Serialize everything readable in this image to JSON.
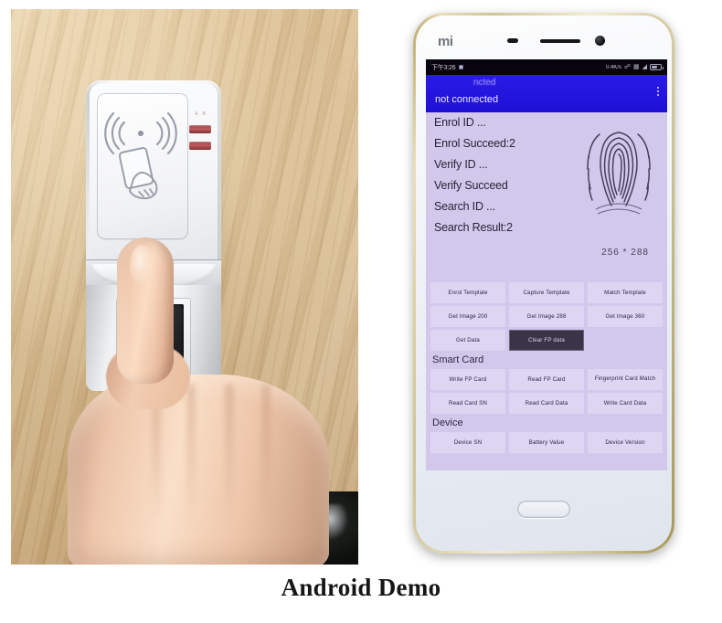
{
  "caption": "Android Demo",
  "left_photo": {
    "alt_name": "fingerprint-rfid-scanner-photo",
    "device_brand_text": "",
    "led_label": "A  B"
  },
  "phone": {
    "brand_logo": "mi",
    "status_bar": {
      "clock": "下午3:26",
      "net_rate": "0.4K/s",
      "icons": [
        "bluetooth-icon",
        "sim-icon",
        "wifi-icon",
        "battery-icon"
      ]
    },
    "action_bar": {
      "ghost_title": "ncted",
      "title": "not connected",
      "overflow_label": "overflow-menu"
    },
    "content": {
      "status_lines": [
        "Enrol ID ...",
        "Enrol Succeed:2",
        "Verify ID ...",
        "Verify Succeed",
        "Search ID ...",
        "Search Result:2"
      ],
      "image_dimensions": "256 * 288",
      "faint_line": "",
      "sections": [
        {
          "label": "",
          "buttons": [
            {
              "label": "Enrol Template",
              "state": "normal"
            },
            {
              "label": "Capture Template",
              "state": "normal"
            },
            {
              "label": "Match Template",
              "state": "normal"
            },
            {
              "label": "Get Image 200",
              "state": "normal"
            },
            {
              "label": "Get Image 288",
              "state": "normal"
            },
            {
              "label": "Get Image 360",
              "state": "normal"
            },
            {
              "label": "Get Data",
              "state": "normal"
            },
            {
              "label": "Clear FP data",
              "state": "pressed"
            },
            {
              "label": "",
              "state": "empty"
            }
          ]
        },
        {
          "label": "Smart Card",
          "buttons": [
            {
              "label": "Write FP Card",
              "state": "normal"
            },
            {
              "label": "Read FP Card",
              "state": "normal"
            },
            {
              "label": "Fingerprint Card Match",
              "state": "normal"
            },
            {
              "label": "Read Card SN",
              "state": "normal"
            },
            {
              "label": "Read Card Data",
              "state": "normal"
            },
            {
              "label": "Write Card Data",
              "state": "normal"
            }
          ]
        },
        {
          "label": "Device",
          "buttons": [
            {
              "label": "Device SN",
              "state": "normal"
            },
            {
              "label": "Battery Value",
              "state": "normal"
            },
            {
              "label": "Device Version",
              "state": "normal"
            }
          ]
        }
      ]
    },
    "hardware": {
      "home_button": "home-button",
      "front_camera": "front-camera",
      "earpiece": "earpiece-speaker",
      "proximity_sensor": "proximity-sensor"
    }
  },
  "colors": {
    "action_bar": "#2417e0",
    "screen_bg": "#d1c8ec",
    "button_bg": "#ddd5f2",
    "button_pressed_bg": "#3b3347",
    "status_bar_bg": "#07030f",
    "caption_text": "#161616"
  }
}
